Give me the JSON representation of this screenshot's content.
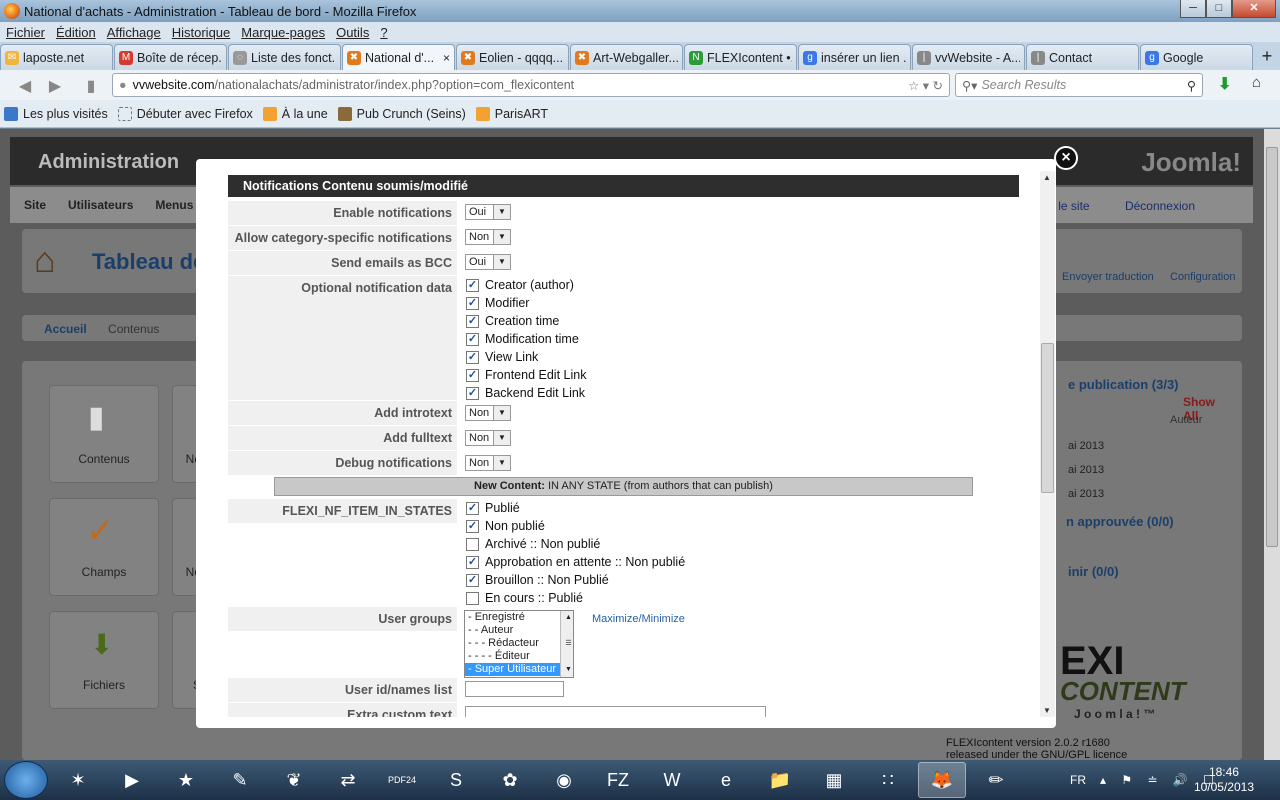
{
  "window": {
    "title": "National d'achats - Administration - Tableau de bord - Mozilla Firefox",
    "min": "─",
    "max": "□",
    "close": "✕"
  },
  "menu": [
    "Fichier",
    "Édition",
    "Affichage",
    "Historique",
    "Marque-pages",
    "Outils",
    "?"
  ],
  "tabs": [
    {
      "label": "laposte.net",
      "icon": "✉",
      "color": "#f1b53c"
    },
    {
      "label": "Boîte de récep...",
      "icon": "M",
      "color": "#d23b2e"
    },
    {
      "label": "Liste des fonct...",
      "icon": "◌",
      "color": "#999999"
    },
    {
      "label": "National d'...",
      "icon": "✖",
      "color": "#e07a1c",
      "active": true
    },
    {
      "label": "Eolien - qqqq...",
      "icon": "✖",
      "color": "#e07a1c"
    },
    {
      "label": "Art-Webgaller...",
      "icon": "✖",
      "color": "#e07a1c"
    },
    {
      "label": "FLEXIcontent •...",
      "icon": "N",
      "color": "#2f9a3a"
    },
    {
      "label": "insérer un lien ...",
      "icon": "g",
      "color": "#3b78e7"
    },
    {
      "label": "vvWebsite - A...",
      "icon": "|",
      "color": "#888888"
    },
    {
      "label": "Contact",
      "icon": "|",
      "color": "#888888"
    },
    {
      "label": "Google",
      "icon": "g",
      "color": "#3b78e7"
    }
  ],
  "tab_close": "×",
  "tab_new": "+",
  "nav": {
    "url_domain": "vvwebsite.com",
    "url_rest": "/nationalachats/administrator/index.php?option=com_flexicontent",
    "search_placeholder": "Search Results"
  },
  "bookmarks": [
    "Les plus visités",
    "Débuter avec Firefox",
    "À la une",
    "Pub Crunch (Seins)",
    "ParisART"
  ],
  "admin": {
    "header": "Administration",
    "brand": "Joomla!",
    "menu": [
      "Site",
      "Utilisateurs",
      "Menus"
    ],
    "view_site": "Voir le site",
    "logout": "Déconnexion",
    "page_title": "Tableau de",
    "subtabs": [
      "Accueil",
      "Contenus"
    ],
    "toolbar_right": [
      "Envoyer traduction",
      "Configuration"
    ],
    "icons": [
      "Contenus",
      "Champs",
      "Fichiers"
    ],
    "icons_partial": [
      "No",
      "No",
      "S"
    ],
    "right_panel": {
      "publication": "e publication (3/3)",
      "show_all": "Show All",
      "col_author": "Auteur",
      "dates": [
        "ai 2013",
        "ai 2013",
        "ai 2013"
      ],
      "approved": "n approuvée (0/0)",
      "define": "inir (0/0)"
    },
    "flexi_brand": "EXI",
    "flexi_brand2": "CONTENT",
    "flexi_joomla": "J o o m l a ! ™",
    "flexi_version": "FLEXIcontent version 2.0.2 r1680",
    "flexi_license": "released under the GNU/GPL licence"
  },
  "modal": {
    "section_title": "Notifications Contenu soumis/modifié",
    "fields": {
      "enable_notifications": {
        "label": "Enable notifications",
        "value": "Oui"
      },
      "allow_category": {
        "label": "Allow category-specific notifications",
        "value": "Non"
      },
      "send_bcc": {
        "label": "Send emails as BCC",
        "value": "Oui"
      },
      "optional_data": {
        "label": "Optional notification data"
      },
      "add_introtext": {
        "label": "Add introtext",
        "value": "Non"
      },
      "add_fulltext": {
        "label": "Add fulltext",
        "value": "Non"
      },
      "debug": {
        "label": "Debug notifications",
        "value": "Non"
      },
      "item_in_states": {
        "label": "FLEXI_NF_ITEM_IN_STATES"
      },
      "user_groups": {
        "label": "User groups"
      },
      "user_ids": {
        "label": "User id/names list",
        "value": ""
      },
      "extra_custom": {
        "label": "Extra custom text",
        "value": ""
      }
    },
    "optional_options": [
      {
        "label": "Creator (author)",
        "checked": true
      },
      {
        "label": "Modifier",
        "checked": true
      },
      {
        "label": "Creation time",
        "checked": true
      },
      {
        "label": "Modification time",
        "checked": true
      },
      {
        "label": "View Link",
        "checked": true
      },
      {
        "label": "Frontend Edit Link",
        "checked": true
      },
      {
        "label": "Backend Edit Link",
        "checked": true
      }
    ],
    "banner_bold": "New Content:",
    "banner_rest": " IN ANY STATE (from authors that can publish)",
    "states": [
      {
        "label": "Publié",
        "checked": true
      },
      {
        "label": "Non publié",
        "checked": true
      },
      {
        "label": "Archivé :: Non publié",
        "checked": false
      },
      {
        "label": "Approbation en attente :: Non publié",
        "checked": true
      },
      {
        "label": "Brouillon :: Non Publié",
        "checked": true
      },
      {
        "label": "En cours :: Publié",
        "checked": false
      }
    ],
    "groups": [
      "- Enregistré",
      "- - Auteur",
      "- - - Rédacteur",
      "- - - - Éditeur",
      "- Super Utilisateur"
    ],
    "groups_selected": "- Super Utilisateur",
    "maximize_label": "Maximize/Minimize"
  },
  "taskbar": {
    "lang": "FR",
    "time": "18:46",
    "date": "10/05/2013",
    "apps": [
      "✶",
      "▶",
      "★",
      "✎",
      "❦",
      "⇄",
      "PDF24",
      "S",
      "✿",
      "◉",
      "FZ",
      "W",
      "e",
      "📁",
      "▦",
      "∷",
      "🦊",
      "✏"
    ]
  }
}
